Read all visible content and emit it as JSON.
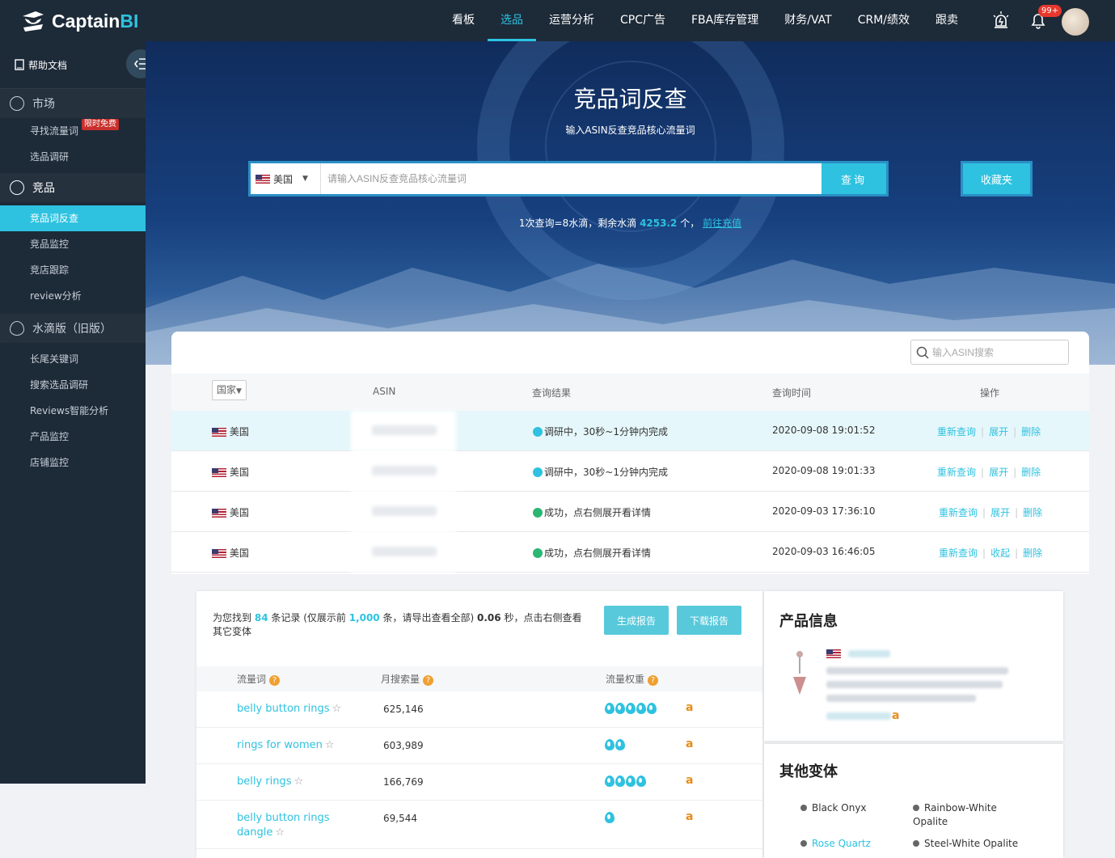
{
  "brand": {
    "name_part1": "Captain",
    "name_part2": "BI"
  },
  "nav": {
    "items": [
      "看板",
      "选品",
      "运营分析",
      "CPC广告",
      "FBA库存管理",
      "财务/VAT",
      "CRM/绩效",
      "跟卖"
    ],
    "active_index": 1,
    "notification_badge": "99+"
  },
  "sidebar": {
    "help": "帮助文档",
    "groups": [
      {
        "label": "市场",
        "items": [
          {
            "label": "寻找流量词",
            "tag": "限时免费"
          },
          {
            "label": "选品调研"
          }
        ]
      },
      {
        "label": "竞品",
        "items": [
          {
            "label": "竞品词反查",
            "active": true
          },
          {
            "label": "竞品监控"
          },
          {
            "label": "竞店跟踪"
          },
          {
            "label": "review分析"
          }
        ]
      },
      {
        "label": "水滴版（旧版）",
        "items": [
          {
            "label": "长尾关键词"
          },
          {
            "label": "搜索选品调研"
          },
          {
            "label": "Reviews智能分析"
          },
          {
            "label": "产品监控"
          },
          {
            "label": "店铺监控"
          }
        ]
      }
    ]
  },
  "hero": {
    "title": "竞品词反查",
    "subtitle": "输入ASIN反查竞品核心流量词",
    "country": "美国",
    "placeholder": "请输入ASIN反查竞品核心流量词",
    "query_button": "查询",
    "fav_button": "收藏夹",
    "quota_prefix": "1次查询=8水滴，剩余水滴",
    "quota_value": "4253.2",
    "quota_suffix": "个，",
    "quota_link": "前往充值"
  },
  "history": {
    "search_placeholder": "输入ASIN搜索",
    "columns": {
      "country": "国家",
      "asin": "ASIN",
      "result": "查询结果",
      "time": "查询时间",
      "ops": "操作"
    },
    "rows": [
      {
        "country": "美国",
        "status": "running",
        "result": "调研中，30秒~1分钟内完成",
        "time": "2020-09-08 19:01:52",
        "ops": [
          "重新查询",
          "展开",
          "删除"
        ]
      },
      {
        "country": "美国",
        "status": "running",
        "result": "调研中，30秒~1分钟内完成",
        "time": "2020-09-08 19:01:33",
        "ops": [
          "重新查询",
          "展开",
          "删除"
        ]
      },
      {
        "country": "美国",
        "status": "success",
        "result": "成功，点右侧展开看详情",
        "time": "2020-09-03 17:36:10",
        "ops": [
          "重新查询",
          "展开",
          "删除"
        ]
      },
      {
        "country": "美国",
        "status": "success",
        "result": "成功，点右侧展开看详情",
        "time": "2020-09-03 16:46:05",
        "ops": [
          "重新查询",
          "收起",
          "删除"
        ]
      }
    ]
  },
  "results": {
    "found_prefix": "为您找到",
    "found_count": "84",
    "found_mid": "条记录 (仅展示前",
    "found_limit": "1,000",
    "found_mid2": "条，请导出查看全部)",
    "found_time": "0.06",
    "found_suffix": "秒，点击右侧查看其它变体",
    "btn_generate": "生成报告",
    "btn_download": "下载报告",
    "col_keyword": "流量词",
    "col_volume": "月搜索量",
    "col_weight": "流量权重",
    "keywords": [
      {
        "kw": "belly button rings",
        "volume": "625,146",
        "weight": 5
      },
      {
        "kw": "rings for women",
        "volume": "603,989",
        "weight": 2
      },
      {
        "kw": "belly rings",
        "volume": "166,769",
        "weight": 4
      },
      {
        "kw": "belly button rings dangle",
        "volume": "69,544",
        "weight": 1
      }
    ]
  },
  "product": {
    "title": "产品信息",
    "amazon_icon": "amazon-icon"
  },
  "variants": {
    "title": "其他变体",
    "items": [
      "Black Onyx",
      "Rainbow-White Opalite",
      "Rose Quartz",
      "Steel-White Opalite"
    ]
  },
  "colors": {
    "accent": "#2ec2e0",
    "dark": "#1d2a38"
  }
}
